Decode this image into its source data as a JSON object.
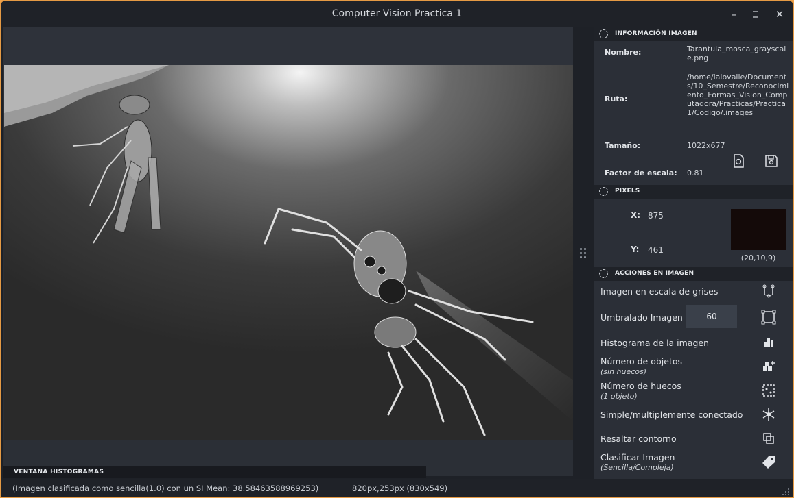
{
  "window": {
    "title": "Computer Vision Practica 1",
    "minimize_glyph": "–",
    "maximize_glyph": "☐",
    "close_glyph": "✕"
  },
  "histogram_window": {
    "label": "VENTANA HISTOGRAMAS",
    "collapse_glyph": "–"
  },
  "info_section": {
    "header": "INFORMACIÓN IMAGEN",
    "name_label": "Nombre:",
    "name_value": "Tarantula_mosca_grayscale.png",
    "path_label": "Ruta:",
    "path_value": "/home/lalovalle/Documents/10_Semestre/Reconocimiento_Formas_Vision_Computadora/Practicas/Practica1/Codigo/.images",
    "size_label": "Tamaño:",
    "size_value": "1022x677",
    "scale_label": "Factor de escala:",
    "scale_value": "0.81",
    "reload_icon": "reload-file-icon",
    "save_icon": "save-icon"
  },
  "pixels_section": {
    "header": "PIXELS",
    "x_label": "X:",
    "x_value": "875",
    "y_label": "Y:",
    "y_value": "461",
    "color_value": "(20,10,9)",
    "color_hex": "#140a09"
  },
  "actions_section": {
    "header": "ACCIONES EN IMAGEN",
    "grayscale_label": "Imagen en escala de grises",
    "threshold_label": "Umbralado Imagen",
    "threshold_value": "60",
    "histogram_label": "Histograma de la imagen",
    "objects_label": "Número de objetos",
    "objects_sub": "(sin huecos)",
    "holes_label": "Número de huecos",
    "holes_sub": "(1 objeto)",
    "connected_label": "Simple/multiplemente conectado",
    "contour_label": "Resaltar contorno",
    "classify_label": "Clasificar Imagen",
    "classify_sub": "(Sencilla/Compleja)"
  },
  "status_bar": {
    "message": "(Imagen clasificada como sencilla(1.0) con un SI Mean: 38.58463588969253)",
    "coords": "820px,253px (830x549)"
  },
  "colors": {
    "accent_border": "#e59a44",
    "panel_bg": "#2b2f37",
    "header_bg": "#1f2228"
  }
}
